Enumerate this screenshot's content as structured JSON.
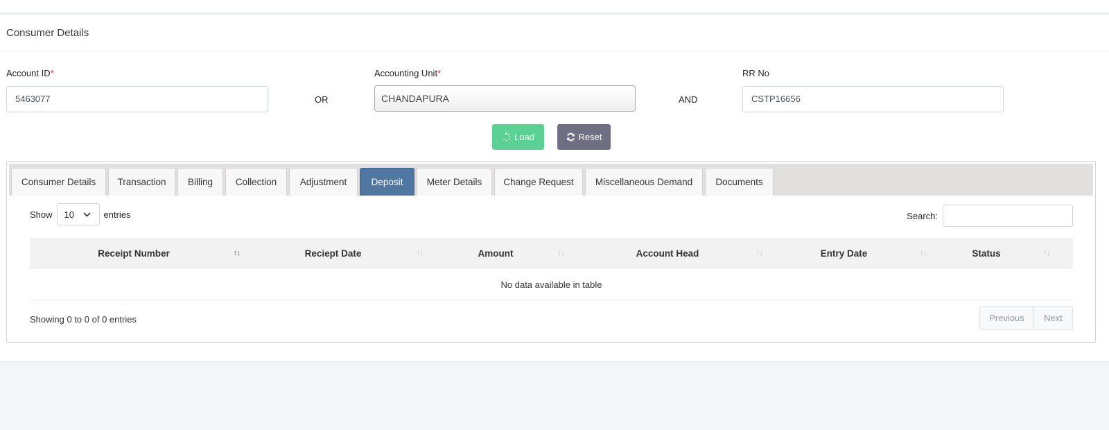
{
  "form": {
    "title": "Consumer Details",
    "account_id_label": "Account ID",
    "required_mark": "*",
    "account_id_value": "5463077",
    "or_label": "OR",
    "accounting_unit_label": "Accounting Unit",
    "accounting_unit_value": "CHANDAPURA",
    "and_label": "AND",
    "rr_no_label": "RR No",
    "rr_no_value": "CSTP16656",
    "load_label": "Load",
    "reset_label": "Reset"
  },
  "tabs": [
    "Consumer Details",
    "Transaction",
    "Billing",
    "Collection",
    "Adjustment",
    "Deposit",
    "Meter Details",
    "Change Request",
    "Miscellaneous Demand",
    "Documents"
  ],
  "active_tab": "Deposit",
  "table": {
    "show_label": "Show",
    "entries_label": "entries",
    "page_length": "10",
    "search_label": "Search:",
    "columns": [
      "Receipt Number",
      "Reciept Date",
      "Amount",
      "Account Head",
      "Entry Date",
      "Status"
    ],
    "empty_message": "No data available in table",
    "info": "Showing 0 to 0 of 0 entries",
    "previous_label": "Previous",
    "next_label": "Next"
  },
  "colors": {
    "load_button": "#5bd294",
    "reset_button": "#6e6f82",
    "active_tab": "#4f77a2",
    "required": "#dc3545"
  }
}
